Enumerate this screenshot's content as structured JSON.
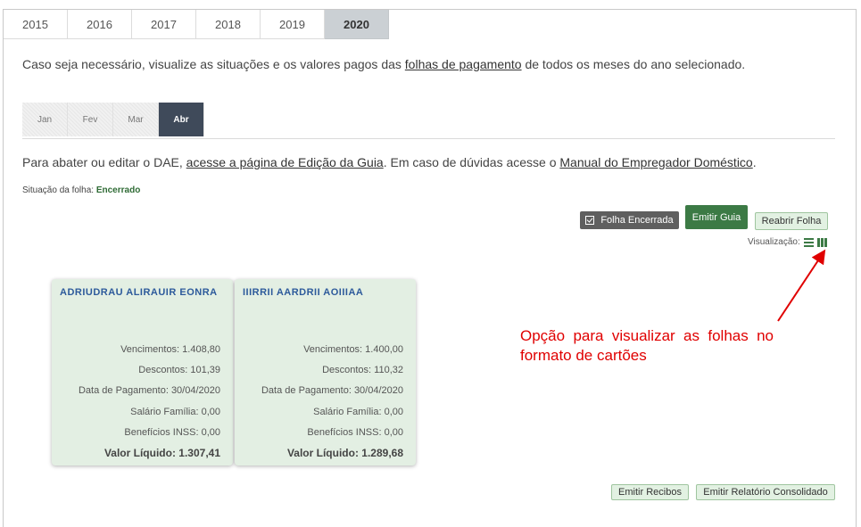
{
  "year_tabs": [
    {
      "label": "2015",
      "active": false
    },
    {
      "label": "2016",
      "active": false
    },
    {
      "label": "2017",
      "active": false
    },
    {
      "label": "2018",
      "active": false
    },
    {
      "label": "2019",
      "active": false
    },
    {
      "label": "2020",
      "active": true
    }
  ],
  "intro": {
    "before": "Caso seja necessário, visualize as situações e os valores pagos das ",
    "link": "folhas de pagamento",
    "after": " de todos os meses do ano selecionado."
  },
  "month_tabs": [
    {
      "label": "Jan",
      "active": false
    },
    {
      "label": "Fev",
      "active": false
    },
    {
      "label": "Mar",
      "active": false
    },
    {
      "label": "Abr",
      "active": true
    }
  ],
  "info": {
    "part1": "Para abater ou editar o DAE, ",
    "link1": "acesse a página de Edição da Guia",
    "part2": ". Em caso de dúvidas acesse o ",
    "link2": "Manual do Empregador Doméstico",
    "part3": "."
  },
  "status": {
    "label": "Situação da folha: ",
    "value": "Encerrado"
  },
  "buttons": {
    "closed": "Folha Encerrada",
    "emit": "Emitir Guia",
    "reopen": "Reabrir Folha",
    "recibos": "Emitir Recibos",
    "relatorio": "Emitir Relatório Consolidado"
  },
  "view": {
    "label": "Visualização:",
    "icons": [
      "list-view-icon",
      "card-view-icon"
    ]
  },
  "cards": [
    {
      "name": "ADRIUDRAU ALIRAUIR EONRA",
      "vencimentos": "Vencimentos: 1.408,80",
      "descontos": "Descontos: 101,39",
      "data_pagamento": "Data de Pagamento: 30/04/2020",
      "salario_familia": "Salário Família: 0,00",
      "beneficios": "Benefícios INSS: 0,00",
      "valor_liquido": "Valor Líquido: 1.307,41"
    },
    {
      "name": "IIIRRII AARDRII AOIIIAA",
      "vencimentos": "Vencimentos: 1.400,00",
      "descontos": "Descontos: 110,32",
      "data_pagamento": "Data de Pagamento: 30/04/2020",
      "salario_familia": "Salário Família: 0,00",
      "beneficios": "Benefícios INSS: 0,00",
      "valor_liquido": "Valor Líquido: 1.289,68"
    }
  ],
  "annotation": "Opção para visualizar as folhas no formato de cartões",
  "colors": {
    "accent_green": "#3c7a45",
    "active_tab": "#cbd0d4",
    "active_month": "#3f4a5a",
    "annotation_red": "#e00000",
    "card_bg": "#e3efe3"
  }
}
